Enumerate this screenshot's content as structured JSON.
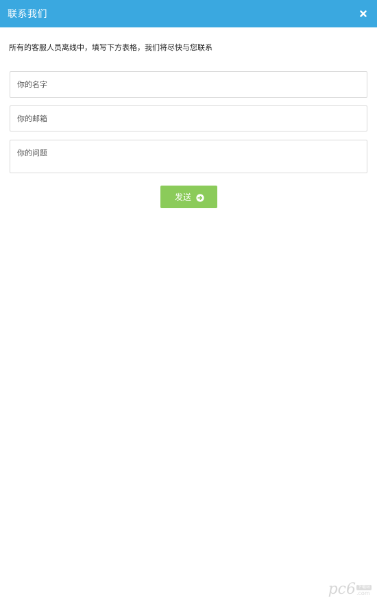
{
  "header": {
    "title": "联系我们",
    "close_icon": "close-icon"
  },
  "intro": {
    "text": "所有的客服人员离线中，填写下方表格，我们将尽快与您联系"
  },
  "form": {
    "name_placeholder": "你的名字",
    "email_placeholder": "你的邮箱",
    "question_placeholder": "你的问题",
    "send_label": "发送",
    "send_icon": "arrow-right-circle-icon"
  },
  "watermark": {
    "main": "pc6",
    "badge": "下载站",
    "suffix": ".com"
  },
  "colors": {
    "header_bg": "#3aa8e0",
    "button_bg": "#8bcb5a",
    "field_border": "#d9d9d9"
  }
}
